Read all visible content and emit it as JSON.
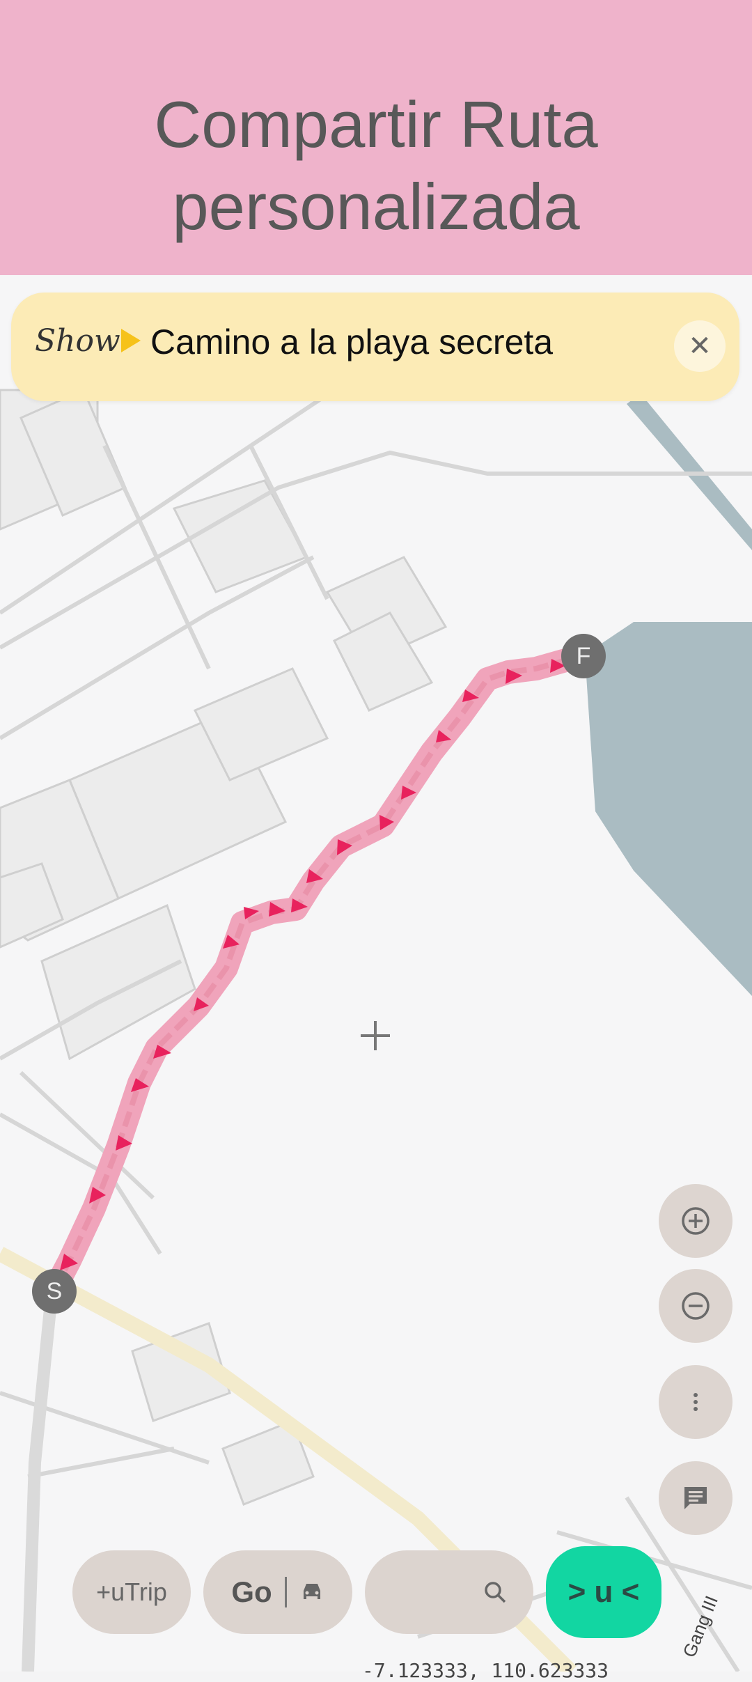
{
  "header": {
    "title": "Compartir Ruta personalizada"
  },
  "banner": {
    "show_label": "Show",
    "route_name": "Camino a la playa secreta",
    "close_icon": "close-icon"
  },
  "markers": {
    "start": "S",
    "finish": "F"
  },
  "map": {
    "street_label": "Gang III",
    "coordinates": "-7.123333, 110.623333",
    "route_color": "#e8225d",
    "water_color": "#aabcc2"
  },
  "controls": {
    "zoom_in_icon": "zoom-in-icon",
    "zoom_out_icon": "zoom-out-icon",
    "more_icon": "more-vert-icon",
    "chat_icon": "chat-icon"
  },
  "bottom_bar": {
    "trip_label": "+uTrip",
    "go_label": "Go",
    "car_icon": "car-icon",
    "search_icon": "search-icon",
    "action_label": "> u <",
    "action_color": "#12d6a2"
  }
}
